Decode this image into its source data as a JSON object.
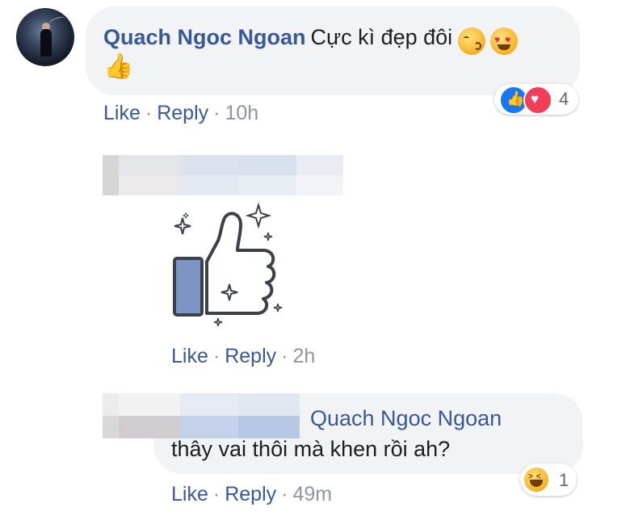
{
  "comment": {
    "author": "Quach Ngoc Ngoan",
    "text": "Cực kì đẹp đôi",
    "emojis": [
      "face-blowing-kiss-icon",
      "heart-eyes-icon",
      "thumbs-up-icon"
    ],
    "reactions": {
      "types": [
        "like",
        "love"
      ],
      "count": "4"
    },
    "actions": {
      "like": "Like",
      "reply": "Reply",
      "separator": "·",
      "time": "10h"
    }
  },
  "sticker_reply": {
    "sticker": "thumbs-up-sparkle-sticker",
    "actions": {
      "like": "Like",
      "reply": "Reply",
      "separator": "·",
      "time": "2h"
    }
  },
  "reply": {
    "mention": "Quach Ngoc Ngoan",
    "text": "thây vai thôi mà khen rồi ah?",
    "reactions": {
      "types": [
        "haha"
      ],
      "count": "1"
    },
    "actions": {
      "like": "Like",
      "reply": "Reply",
      "separator": "·",
      "time": "49m"
    }
  },
  "colors": {
    "link": "#385898",
    "bubble": "#f2f3f5",
    "meta": "#90949c",
    "like_blue": "#1877f2",
    "love_red": "#f33e58",
    "sticker_blue": "#7c95c4"
  }
}
